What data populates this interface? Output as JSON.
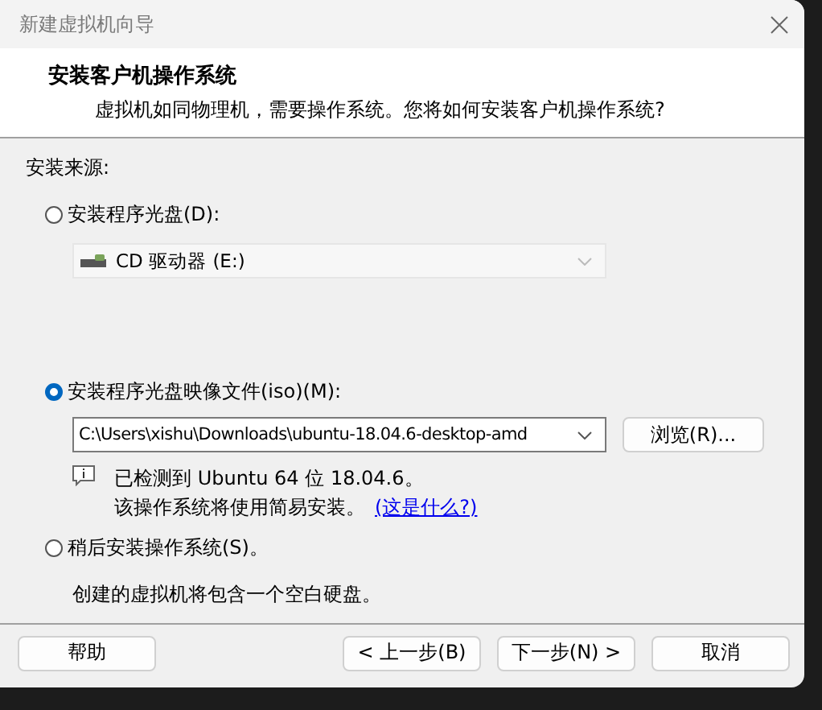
{
  "window": {
    "title": "新建虚拟机向导"
  },
  "header": {
    "title": "安装客户机操作系统",
    "subtitle": "虚拟机如同物理机，需要操作系统。您将如何安装客户机操作系统?"
  },
  "source_label": "安装来源:",
  "options": [
    {
      "kind": "disc",
      "label": "安装程序光盘(D):",
      "selected": false,
      "drive": {
        "value": "CD 驱动器 (E:)",
        "disabled": true
      }
    },
    {
      "kind": "iso",
      "label": "安装程序光盘映像文件(iso)(M):",
      "selected": true,
      "path": "C:\\Users\\xishu\\Downloads\\ubuntu-18.04.6-desktop-amd",
      "browse": "浏览(R)...",
      "detected": "已检测到 Ubuntu 64 位 18.04.6。",
      "note": "该操作系统将使用简易安装。",
      "link": "(这是什么?)"
    },
    {
      "kind": "later",
      "label": "稍后安装操作系统(S)。",
      "selected": false,
      "description": "创建的虚拟机将包含一个空白硬盘。"
    }
  ],
  "buttons": [
    {
      "label": "帮助",
      "kind": "help"
    },
    {
      "label": "< 上一步(B)",
      "kind": "nav"
    },
    {
      "label": "下一步(N) >",
      "kind": "nav"
    },
    {
      "label": "取消",
      "kind": "nav"
    }
  ]
}
